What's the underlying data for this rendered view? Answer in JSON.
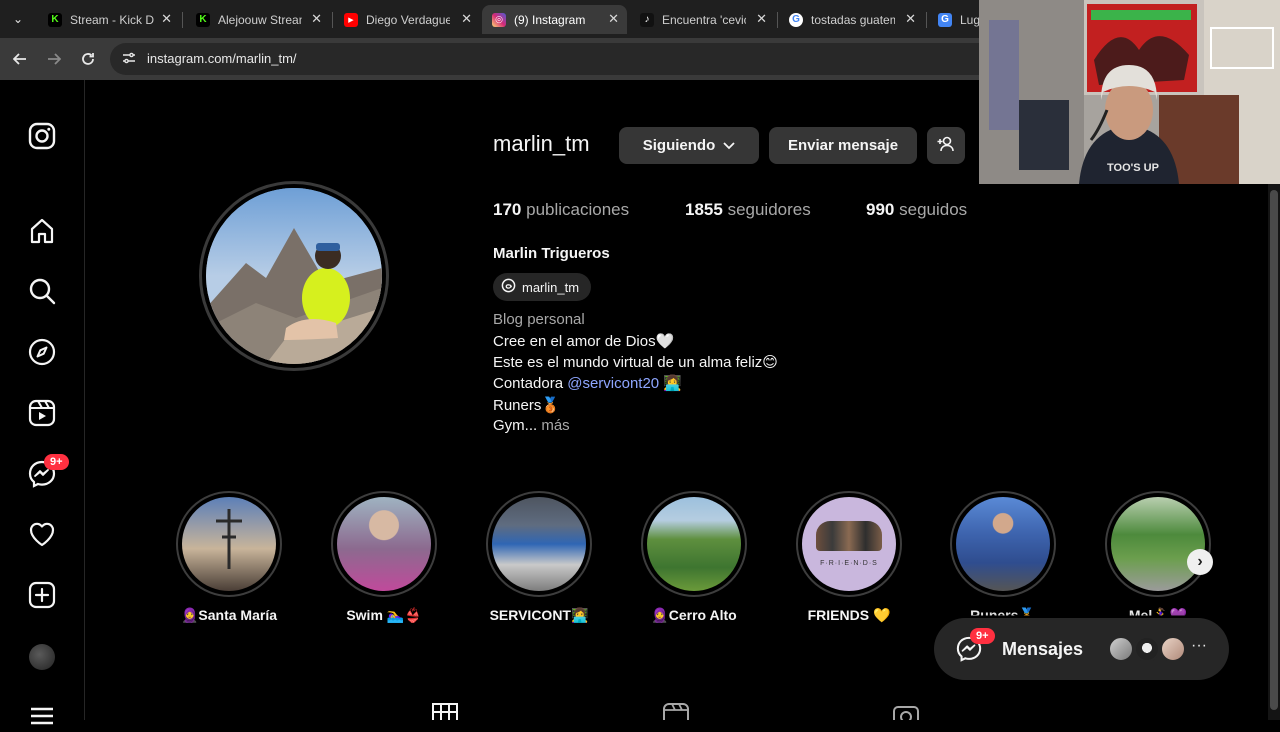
{
  "browser": {
    "tabs": [
      {
        "title": "Stream - Kick Da",
        "favicon": "kick-icon",
        "color": "#53fc18",
        "glyph": "K"
      },
      {
        "title": "Alejoouw Stream",
        "favicon": "kick-icon",
        "color": "#53fc18",
        "glyph": "K"
      },
      {
        "title": "Diego Verdague",
        "favicon": "youtube-icon",
        "color": "#ff0000",
        "glyph": "▶"
      },
      {
        "title": "(9) Instagram",
        "favicon": "instagram-icon",
        "color": "#d6249f",
        "glyph": "◎"
      },
      {
        "title": "Encuentra 'cevic",
        "favicon": "tiktok-icon",
        "color": "#111111",
        "glyph": "♪"
      },
      {
        "title": "tostadas guatem",
        "favicon": "google-icon",
        "color": "#ffffff",
        "glyph": "G"
      },
      {
        "title": "Luga",
        "favicon": "google-translate-icon",
        "color": "#4285f4",
        "glyph": "G"
      }
    ],
    "url": "instagram.com/marlin_tm/"
  },
  "sidebar": {
    "messages_badge": "9+"
  },
  "profile": {
    "username": "marlin_tm",
    "following_label": "Siguiendo",
    "message_label": "Enviar mensaje",
    "posts_count": "170",
    "posts_label": "publicaciones",
    "followers_count": "1855",
    "followers_label": "seguidores",
    "following_count": "990",
    "following_label_stat": "seguidos",
    "full_name": "Marlin Trigueros",
    "threads_handle": "marlin_tm",
    "category": "Blog personal",
    "bio_line1": "Cree en el amor de Dios🤍",
    "bio_line2": "Este es el mundo virtual de un alma feliz😊",
    "bio_line3_prefix": "Contadora ",
    "bio_line3_link": "@servicont20",
    "bio_line3_suffix": " 👩‍💻",
    "bio_line4": "Runers🥉",
    "bio_line5": "Gym...",
    "bio_more": "más"
  },
  "highlights": [
    {
      "label": "🧕Santa María"
    },
    {
      "label": "Swim 🏊‍♀️👙"
    },
    {
      "label": "SERVICONT👩‍💻"
    },
    {
      "label": "🧕Cerro Alto"
    },
    {
      "label": "FRIENDS 💛"
    },
    {
      "label": "Runers🏅"
    },
    {
      "label": "Mel🏃‍♀️💜"
    }
  ],
  "friends_text": "F·R·I·E·N·D·S",
  "messages": {
    "label": "Mensajes",
    "badge": "9+"
  },
  "webcam": {
    "shirt_text": "TOO'S UP"
  }
}
